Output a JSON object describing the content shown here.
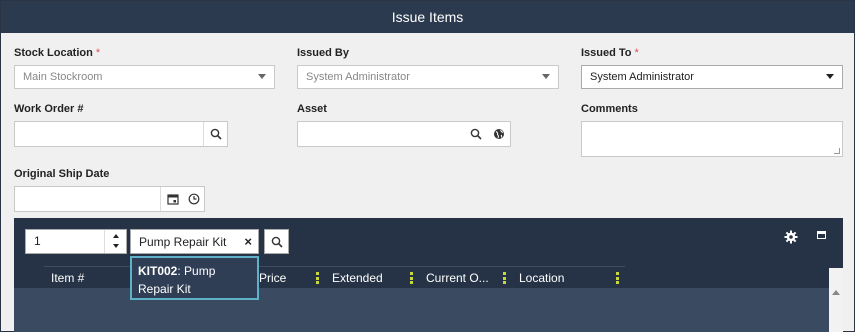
{
  "dialog": {
    "title": "Issue Items"
  },
  "form": {
    "stock_location": {
      "label": "Stock Location",
      "required": "*",
      "value": "Main Stockroom"
    },
    "issued_by": {
      "label": "Issued By",
      "value": "System Administrator"
    },
    "issued_to": {
      "label": "Issued To",
      "required": "*",
      "value": "System Administrator"
    },
    "work_order": {
      "label": "Work Order #",
      "value": ""
    },
    "asset": {
      "label": "Asset",
      "value": ""
    },
    "comments": {
      "label": "Comments",
      "value": ""
    },
    "original_ship_date": {
      "label": "Original Ship Date",
      "value": ""
    }
  },
  "grid": {
    "quantity": "1",
    "item_search": "Pump Repair Kit",
    "columns": [
      {
        "label": "Item #"
      },
      {
        "label": "Price"
      },
      {
        "label": "Extended"
      },
      {
        "label": "Current O..."
      },
      {
        "label": "Location"
      }
    ]
  },
  "autocomplete": {
    "code": "KIT002",
    "separator": ":",
    "name": "Pump Repair Kit"
  },
  "icons": {
    "search": "search-icon",
    "globe": "globe-icon",
    "calendar": "calendar-icon",
    "clock": "clock-icon",
    "gear": "gear-icon",
    "maximize": "maximize-icon",
    "clear": "clear-icon"
  },
  "colors": {
    "titlebar": "#2b3a4f",
    "panel": "#263346",
    "column_menu_dots": "#c8d83a",
    "required": "#e05050",
    "dropdown_border": "#5fb0c9"
  }
}
